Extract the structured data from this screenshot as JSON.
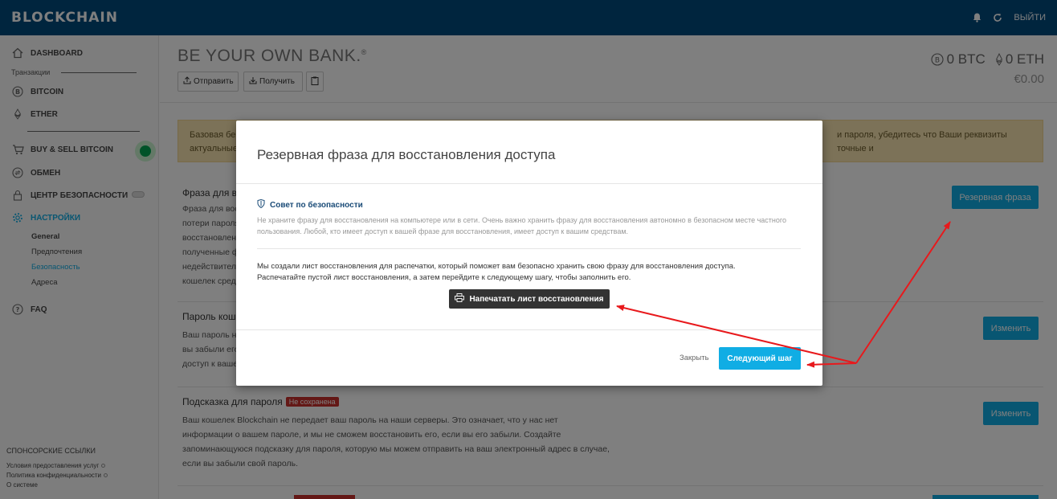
{
  "app": {
    "logo": "BLOCKCHAIN",
    "logout_label": "ВЫЙТИ"
  },
  "sidebar": {
    "dashboard": "DASHBOARD",
    "transactions_section": "Транзакции",
    "bitcoin": "BITCOIN",
    "ether": "ETHER",
    "buy_sell": "BUY & SELL BITCOIN",
    "exchange": "ОБМЕН",
    "security_center": "ЦЕНТР БЕЗОПАСНОСТИ",
    "settings": "НАСТРОЙКИ",
    "sub_general": "General",
    "sub_preferences": "Предпочтения",
    "sub_security": "Безопасность",
    "sub_addresses": "Адреса",
    "faq": "FAQ",
    "sponsor_title": "СПОНСОРСКИЕ ССЫЛКИ",
    "terms": "Условия предоставления услуг",
    "privacy": "Политика конфиденциальности",
    "about": "О системе"
  },
  "header": {
    "title": "BE YOUR OWN BANK.",
    "title_mark": "®",
    "send_label": "Отправить",
    "receive_label": "Получить",
    "btc_balance": "0 BTC",
    "eth_balance": "0 ETH",
    "fiat_balance": "€0.00"
  },
  "main": {
    "warning_line1_left": "Базовая бе",
    "warning_line1_right": "и пароля, убедитесь что Ваши реквизиты точные и",
    "warning_line2": "актуальные",
    "section1_title": "Фраза для в",
    "section1_lines": [
      "Фраза для вос",
      "потери пароля",
      "восстановлен",
      "полученные ф",
      "недействител",
      "кошелек сред"
    ],
    "section1_button": "Резервная фраза",
    "section2_title": "Пароль коше",
    "section2_lines": [
      "Ваш пароль н",
      "вы забыли его",
      "доступ к ваше"
    ],
    "section2_button": "Изменить",
    "section3_title": "Подсказка для пароля",
    "section3_badge": "Не сохранена",
    "section3_lines": [
      "Ваш кошелек Blockchain не передает ваш пароль на наши серверы. Это означает, что у нас нет",
      "информации о вашем пароле, и мы не сможем восстановить его, если вы его забыли. Создайте",
      "запоминающуюся подсказку для пароля, которую мы можем отправить на ваш электронный адрес в случае,",
      "если вы забыли свой пароль."
    ],
    "section3_button": "Изменить"
  },
  "modal": {
    "title": "Резервная фраза для восстановления доступа",
    "tip_title": "Совет по безопасности",
    "tip_text": "Не храните фразу для восстановления на компьютере или в сети. Очень важно хранить фразу для восстановления автономно в безопасном месте частного пользования. Любой, кто имеет доступ к вашей фразе для восстановления, имеет доступ к вашим средствам.",
    "desc_line1": "Мы создали лист восстановления для распечатки, который поможет вам безопасно хранить свою фразу для восстановления доступа.",
    "desc_line2": "Распечатайте пустой лист восстановления, а затем перейдите к следующему шагу, чтобы заполнить его.",
    "print_label": "Напечатать лист восстановления",
    "close_label": "Закрыть",
    "next_label": "Следующий шаг"
  },
  "colors": {
    "topbar": "#004a7c",
    "accent": "#10ade4",
    "annotation_arrow": "#e8191c",
    "status_dot": "#00a651",
    "badge": "#c9302c"
  }
}
